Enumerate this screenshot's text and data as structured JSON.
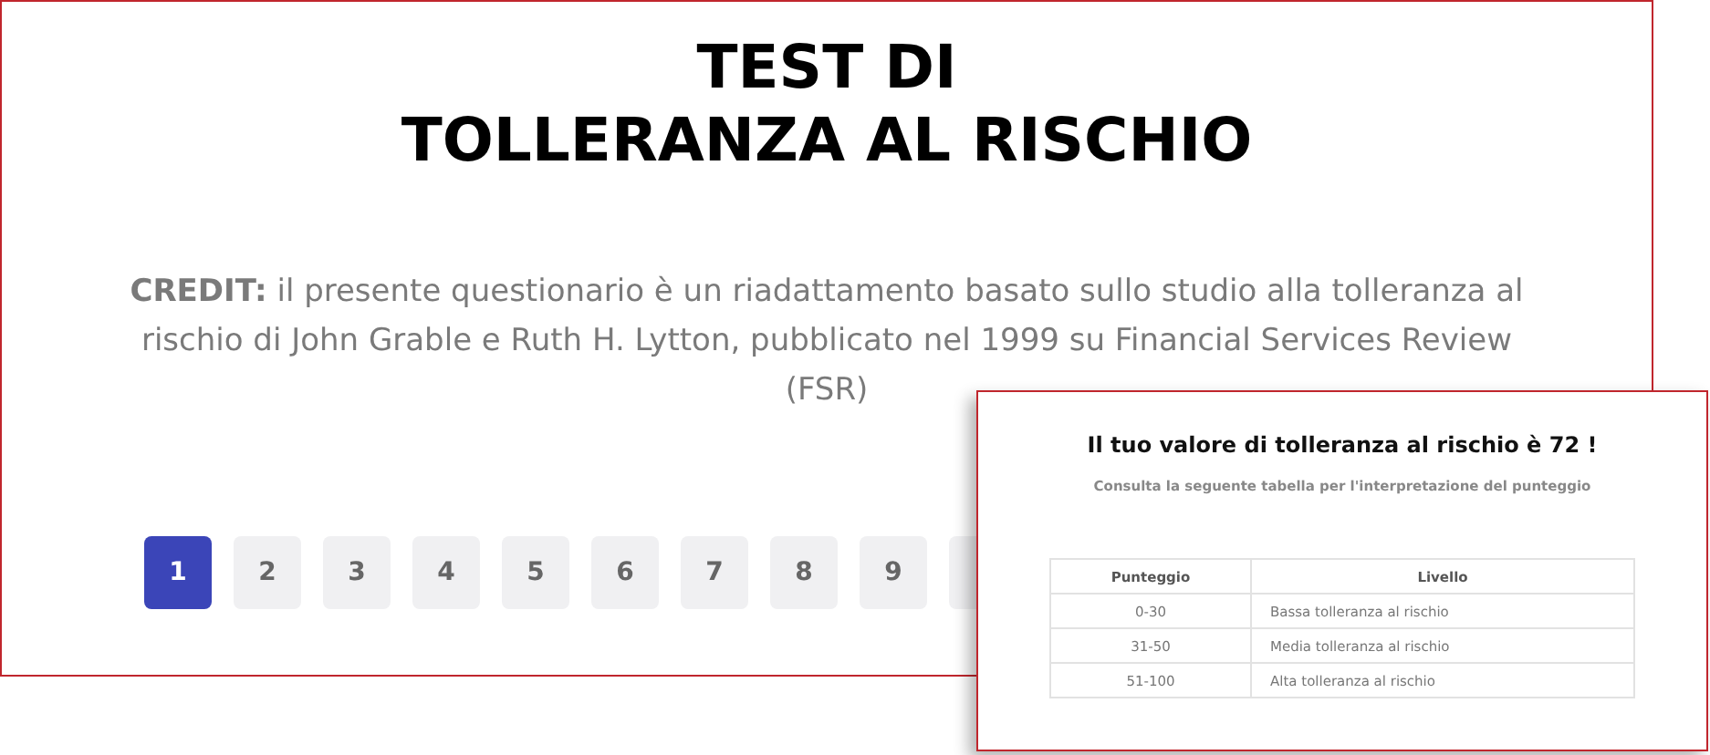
{
  "main": {
    "title_lines": [
      "TEST DI",
      "TOLLERANZA AL RISCHIO"
    ],
    "credit": "**CREDIT:** il presente questionario è un riadattamento basato sullo studio alla tolleranza al rischio di John Grable e Ruth H. Lytton, pubblicato nel 1999 su Financial Services Review (FSR)",
    "pages": [
      {
        "label": "1",
        "selected": true
      },
      {
        "label": "2",
        "selected": false
      },
      {
        "label": "3",
        "selected": false
      },
      {
        "label": "4",
        "selected": false
      },
      {
        "label": "5",
        "selected": false
      },
      {
        "label": "6",
        "selected": false
      },
      {
        "label": "7",
        "selected": false
      },
      {
        "label": "8",
        "selected": false
      },
      {
        "label": "9",
        "selected": false
      }
    ]
  },
  "result": {
    "title": "Il tuo valore di tolleranza al rischio è 72 !",
    "subtitle": "Consulta la seguente tabella per l'interpretazione del punteggio",
    "table": {
      "columns": [
        "Punteggio",
        "Livello"
      ],
      "rows": [
        [
          "0-30",
          "Bassa tolleranza al rischio"
        ],
        [
          "31-50",
          "Media tolleranza al rischio"
        ],
        [
          "51-100",
          "Alta tolleranza al rischio"
        ]
      ]
    }
  }
}
